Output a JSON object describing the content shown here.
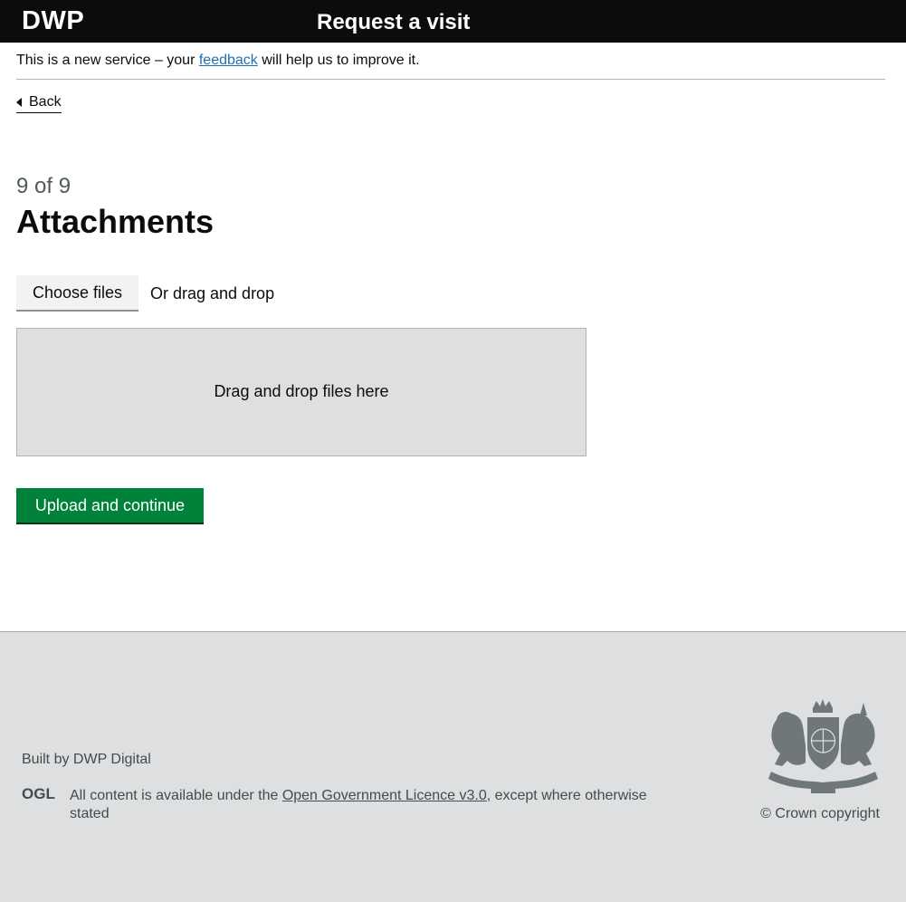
{
  "header": {
    "logo": "DWP",
    "service_name": "Request a visit"
  },
  "banner": {
    "before": "This is a new service – your ",
    "link": "feedback",
    "after": " will help us to improve it."
  },
  "back_link": "Back",
  "step_caption": "9 of 9",
  "page_title": "Attachments",
  "upload": {
    "choose_button": "Choose files",
    "or_drag": "Or drag and drop",
    "dropzone_text": "Drag and drop files here"
  },
  "submit_button": "Upload and continue",
  "footer": {
    "built_by": "Built by DWP Digital",
    "ogl_label": "OGL",
    "licence_before": "All content is available under the ",
    "licence_link": "Open Government Licence v3.0",
    "licence_after": ", except where otherwise stated",
    "crest_icon": "royal-coat-of-arms-icon",
    "copyright": "© Crown copyright"
  },
  "colors": {
    "header_bg": "#0b0c0c",
    "link": "#1d70b8",
    "primary_button": "#00823b",
    "footer_bg": "#dedfe0"
  }
}
